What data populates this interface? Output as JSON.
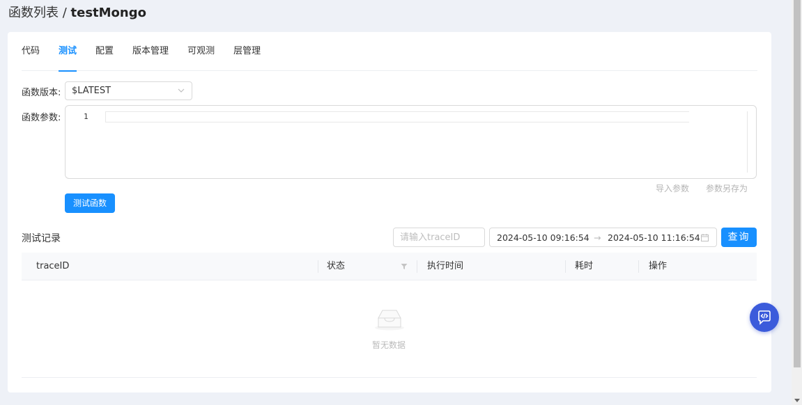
{
  "header": {
    "breadcrumb_parent": "函数列表",
    "breadcrumb_sep": " / ",
    "breadcrumb_current": "testMongo"
  },
  "tabs": [
    {
      "label": "代码",
      "active": false
    },
    {
      "label": "测试",
      "active": true
    },
    {
      "label": "配置",
      "active": false
    },
    {
      "label": "版本管理",
      "active": false
    },
    {
      "label": "可观测",
      "active": false
    },
    {
      "label": "层管理",
      "active": false
    }
  ],
  "form": {
    "version_label": "函数版本:",
    "version_value": "$LATEST",
    "params_label": "函数参数:",
    "editor_line_number": "1",
    "import_label": "导入参数",
    "save_as_label": "参数另存为",
    "test_button": "测试函数"
  },
  "records": {
    "title": "测试记录",
    "trace_placeholder": "请输入traceID",
    "range_start": "2024-05-10 09:16:54",
    "range_sep": "→",
    "range_end": "2024-05-10 11:16:54",
    "search_button": "查询",
    "columns": [
      "traceID",
      "状态",
      "执行时间",
      "耗时",
      "操作"
    ],
    "empty_text": "暂无数据"
  },
  "colors": {
    "accent": "#1890ff",
    "float_button": "#3b5bdb"
  },
  "icons": {
    "select_arrow": "chevron-down-icon",
    "calendar": "calendar-icon",
    "filter": "filter-icon",
    "empty": "empty-inbox-icon",
    "float": "code-chat-icon"
  }
}
